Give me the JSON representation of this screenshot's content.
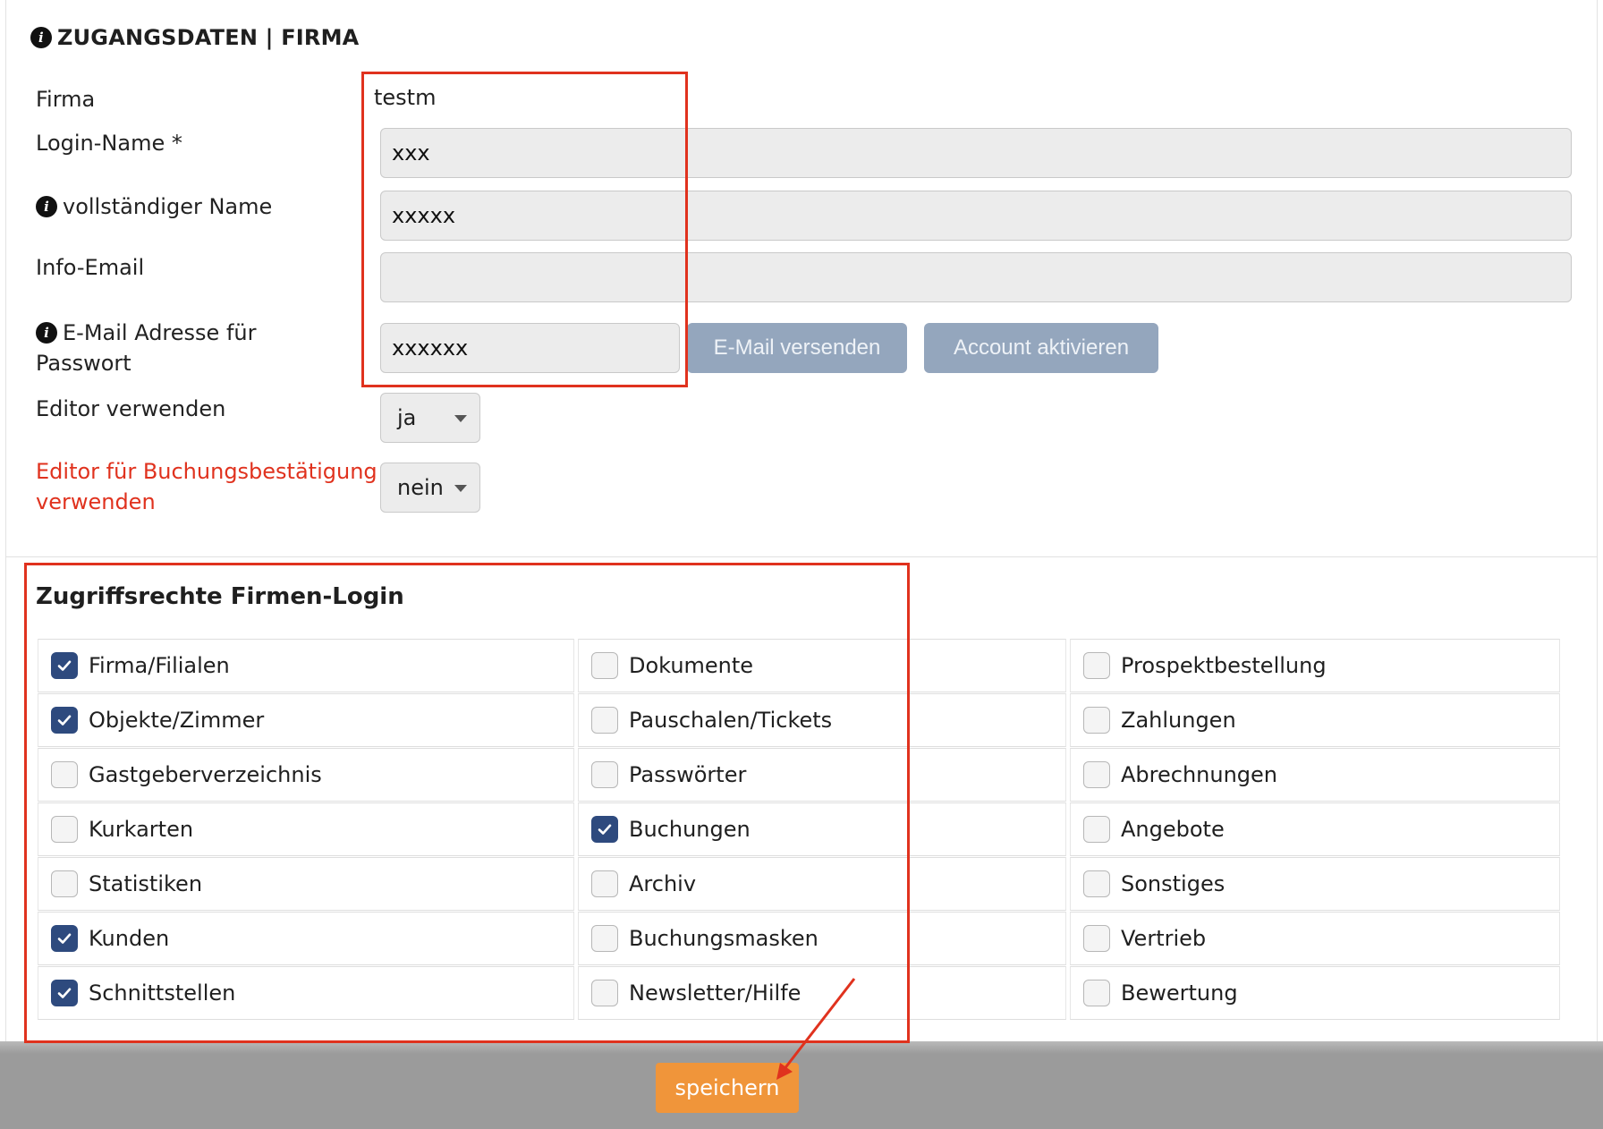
{
  "section": {
    "title": "ZUGANGSDATEN | FIRMA"
  },
  "form": {
    "firma_label": "Firma",
    "firma_value": "testm",
    "login_label": "Login-Name *",
    "login_value": "xxx",
    "fullname_label": "vollständiger Name",
    "fullname_value": "xxxxx",
    "infoemail_label": "Info-Email",
    "infoemail_value": "",
    "pwemail_label_line1": "E-Mail Adresse für",
    "pwemail_label_line2": "Passwort",
    "pwemail_value": "xxxxxx",
    "send_email_button": "E-Mail versenden",
    "activate_button": "Account aktivieren",
    "editor_label": "Editor verwenden",
    "editor_value": "ja",
    "editor_booking_label_line1": "Editor für Buchungsbestätigung",
    "editor_booking_label_line2": "verwenden",
    "editor_booking_value": "nein"
  },
  "permissions": {
    "title": "Zugriffsrechte Firmen-Login",
    "columns": [
      [
        {
          "label": "Firma/Filialen",
          "checked": true
        },
        {
          "label": "Objekte/Zimmer",
          "checked": true
        },
        {
          "label": "Gastgeberverzeichnis",
          "checked": false
        },
        {
          "label": "Kurkarten",
          "checked": false
        },
        {
          "label": "Statistiken",
          "checked": false
        },
        {
          "label": "Kunden",
          "checked": true
        },
        {
          "label": "Schnittstellen",
          "checked": true
        }
      ],
      [
        {
          "label": "Dokumente",
          "checked": false
        },
        {
          "label": "Pauschalen/Tickets",
          "checked": false
        },
        {
          "label": "Passwörter",
          "checked": false
        },
        {
          "label": "Buchungen",
          "checked": true
        },
        {
          "label": "Archiv",
          "checked": false
        },
        {
          "label": "Buchungsmasken",
          "checked": false
        },
        {
          "label": "Newsletter/Hilfe",
          "checked": false
        }
      ],
      [
        {
          "label": "Prospektbestellung",
          "checked": false
        },
        {
          "label": "Zahlungen",
          "checked": false
        },
        {
          "label": "Abrechnungen",
          "checked": false
        },
        {
          "label": "Angebote",
          "checked": false
        },
        {
          "label": "Sonstiges",
          "checked": false
        },
        {
          "label": "Vertrieb",
          "checked": false
        },
        {
          "label": "Bewertung",
          "checked": false
        }
      ]
    ]
  },
  "footer": {
    "save_label": "speichern"
  },
  "colors": {
    "accent_red": "#e0321e",
    "checkbox_on": "#2e4a7e",
    "save_orange": "#f0953a",
    "disabled_button": "#94a6bd"
  }
}
